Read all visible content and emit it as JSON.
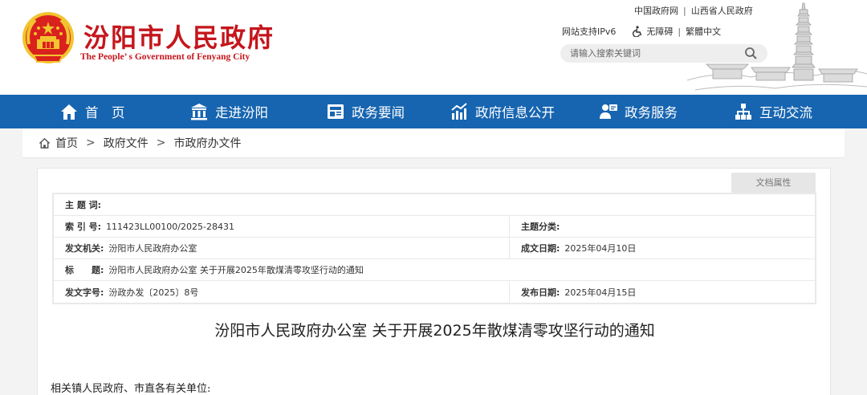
{
  "header": {
    "title": "汾阳市人民政府",
    "subtitle": "The People’ s Government of Fenyang City",
    "top_links": [
      "中国政府网",
      "山西省人民政府"
    ],
    "ipv6": "网站支持IPv6",
    "accessibility": "无障碍",
    "traditional": "繁體中文",
    "search_placeholder": "请输入搜索关键词"
  },
  "nav": [
    {
      "label": "首　页",
      "icon": "home-icon"
    },
    {
      "label": "走进汾阳",
      "icon": "building-icon"
    },
    {
      "label": "政务要闻",
      "icon": "newspaper-icon"
    },
    {
      "label": "政府信息公开",
      "icon": "chart-icon"
    },
    {
      "label": "政务服务",
      "icon": "service-icon"
    },
    {
      "label": "互动交流",
      "icon": "network-icon"
    }
  ],
  "breadcrumb": [
    "首页",
    "政府文件",
    "市政府办文件"
  ],
  "doc_tab": "文档属性",
  "meta": {
    "keywords_label": "主 题 词:",
    "keywords": "",
    "index_label": "索 引 号:",
    "index": "111423LL00100/2025-28431",
    "category_label": "主题分类:",
    "category": "",
    "issuer_label": "发文机关:",
    "issuer": "汾阳市人民政府办公室",
    "created_label": "成文日期:",
    "created": "2025年04月10日",
    "title_label": "标　　题:",
    "title": "汾阳市人民政府办公室 关于开展2025年散煤清零攻坚行动的通知",
    "docno_label": "发文字号:",
    "docno": "汾政办发〔2025〕8号",
    "published_label": "发布日期:",
    "published": "2025年04月15日"
  },
  "doc_title": "汾阳市人民政府办公室 关于开展2025年散煤清零攻坚行动的通知",
  "doc_body": "相关镇人民政府、市直各有关单位:",
  "colors": {
    "nav_blue": "#1765b0",
    "brand_red": "#c4161c"
  }
}
